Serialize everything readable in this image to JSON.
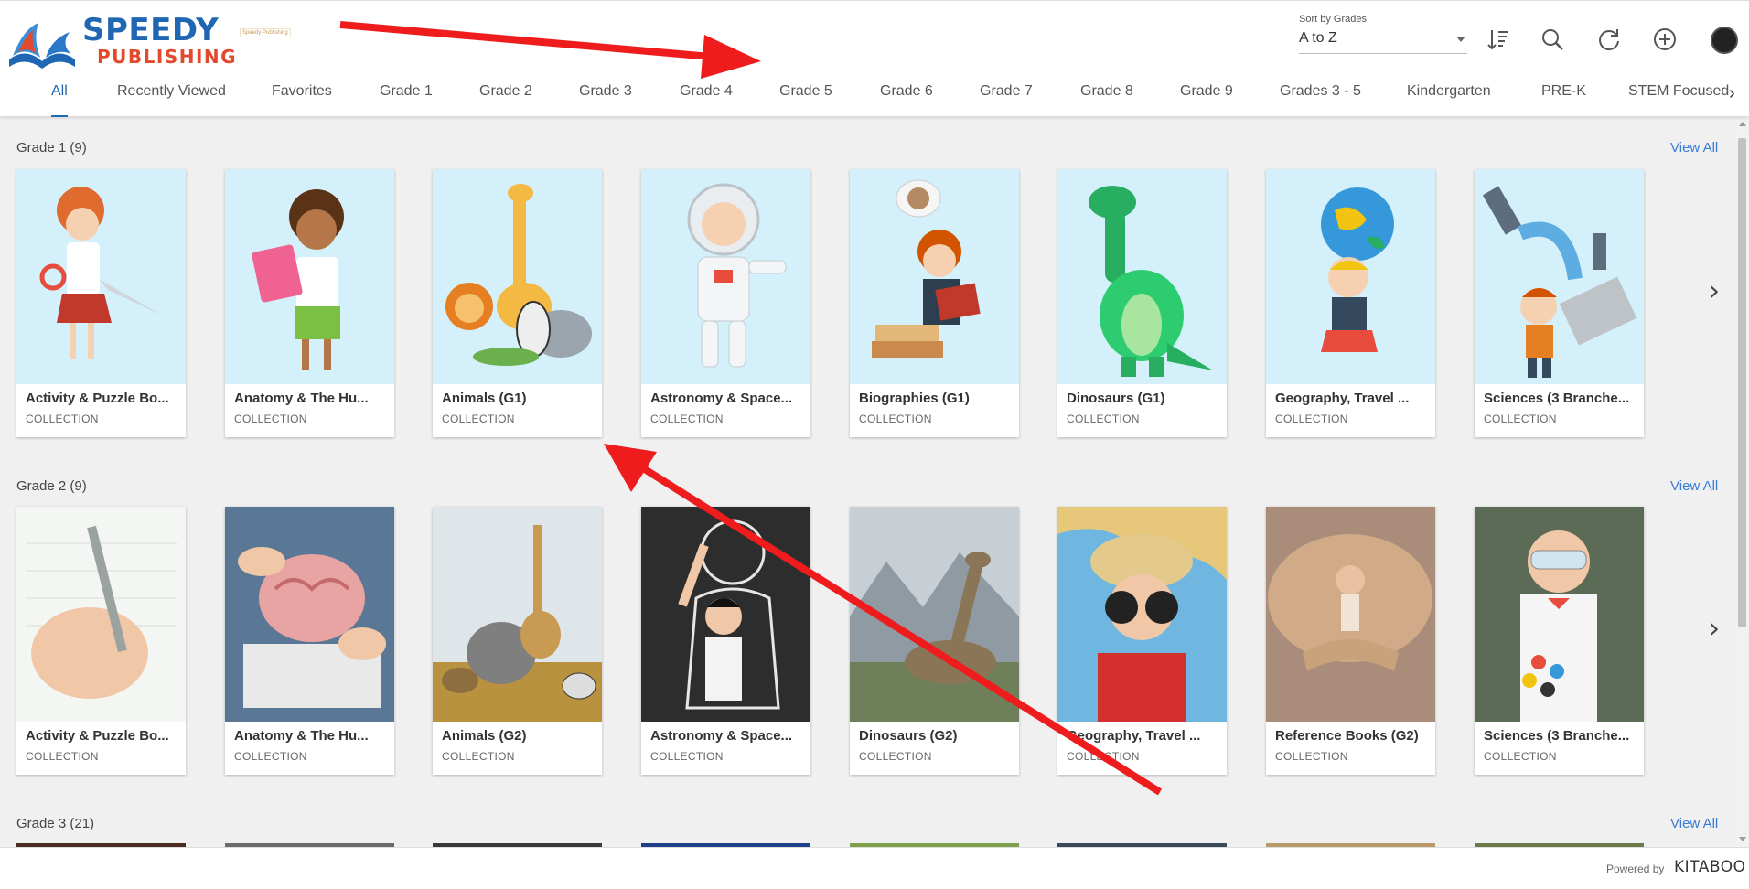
{
  "header": {
    "logo": {
      "line1": "SPEEDY",
      "line2": "PUBLISHING",
      "small": "Speedy Publishing"
    },
    "sort": {
      "label": "Sort by Grades",
      "value": "A to Z"
    },
    "icons": [
      "sort-order-icon",
      "search-icon",
      "refresh-icon",
      "add-icon",
      "avatar"
    ]
  },
  "tabs": [
    {
      "label": "All",
      "active": true
    },
    {
      "label": "Recently Viewed"
    },
    {
      "label": "Favorites"
    },
    {
      "label": "Grade 1"
    },
    {
      "label": "Grade 2"
    },
    {
      "label": "Grade 3"
    },
    {
      "label": "Grade 4"
    },
    {
      "label": "Grade 5"
    },
    {
      "label": "Grade 6"
    },
    {
      "label": "Grade 7"
    },
    {
      "label": "Grade 8"
    },
    {
      "label": "Grade 9"
    },
    {
      "label": "Grades 3 - 5"
    },
    {
      "label": "Kindergarten"
    },
    {
      "label": "PRE-K"
    },
    {
      "label": "STEM Focused"
    }
  ],
  "sections": [
    {
      "title": "Grade 1 (9)",
      "view_all": "View All",
      "cards": [
        {
          "title": "Activity & Puzzle Bo...",
          "type": "COLLECTION"
        },
        {
          "title": "Anatomy & The Hu...",
          "type": "COLLECTION"
        },
        {
          "title": "Animals (G1)",
          "type": "COLLECTION"
        },
        {
          "title": "Astronomy & Space...",
          "type": "COLLECTION"
        },
        {
          "title": "Biographies (G1)",
          "type": "COLLECTION"
        },
        {
          "title": "Dinosaurs (G1)",
          "type": "COLLECTION"
        },
        {
          "title": "Geography, Travel ...",
          "type": "COLLECTION"
        },
        {
          "title": "Sciences (3 Branche...",
          "type": "COLLECTION"
        }
      ]
    },
    {
      "title": "Grade 2 (9)",
      "view_all": "View All",
      "cards": [
        {
          "title": "Activity & Puzzle Bo...",
          "type": "COLLECTION"
        },
        {
          "title": "Anatomy & The Hu...",
          "type": "COLLECTION"
        },
        {
          "title": "Animals (G2)",
          "type": "COLLECTION"
        },
        {
          "title": "Astronomy & Space...",
          "type": "COLLECTION"
        },
        {
          "title": "Dinosaurs (G2)",
          "type": "COLLECTION"
        },
        {
          "title": "Geography, Travel ...",
          "type": "COLLECTION"
        },
        {
          "title": "Reference Books (G2)",
          "type": "COLLECTION"
        },
        {
          "title": "Sciences (3 Branche...",
          "type": "COLLECTION"
        }
      ]
    },
    {
      "title": "Grade 3 (21)",
      "view_all": "View All"
    }
  ],
  "footer": {
    "powered": "Powered by",
    "brand": "KITABOO"
  },
  "colors": {
    "accent": "#1f67b3",
    "link": "#3a7bd5",
    "annotation_arrow": "#ee1c1c"
  }
}
